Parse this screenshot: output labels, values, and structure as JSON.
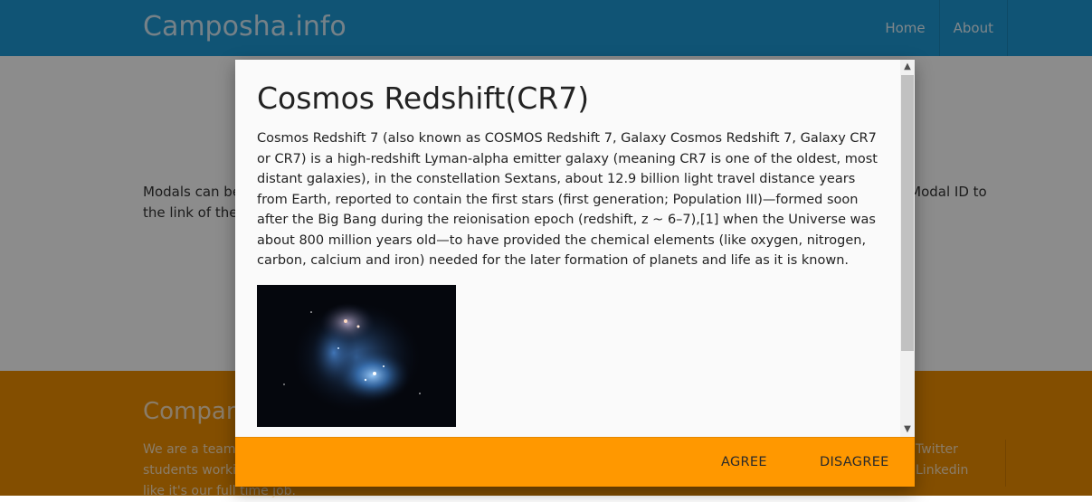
{
  "navbar": {
    "brand": "Camposha.info",
    "links": [
      "Home",
      "About"
    ]
  },
  "main": {
    "text": "Modals can be used for alerts, dialogs, preview lightboxes and more. For the modal to work you have to add the Modal ID to the link of the trigger."
  },
  "footer": {
    "title": "Company Bio",
    "text": "We are a team of college students working on this project like it's our full time job.",
    "links": [
      "Twitter",
      "Linkedin"
    ]
  },
  "modal": {
    "title": "Cosmos Redshift(CR7)",
    "body": "Cosmos Redshift 7 (also known as COSMOS Redshift 7, Galaxy Cosmos Redshift 7, Galaxy CR7 or CR7) is a high-redshift Lyman-alpha emitter galaxy (meaning CR7 is one of the oldest, most distant galaxies), in the constellation Sextans, about 12.9 billion light travel distance years from Earth, reported to contain the first stars (first generation; Population III)—formed soon after the Big Bang during the reionisation epoch (redshift, z ~ 6–7),[1] when the Universe was about 800 million years old—to have provided the chemical elements (like oxygen, nitrogen, carbon, calcium and iron) needed for the later formation of planets and life as it is known.",
    "agree_label": "AGREE",
    "disagree_label": "DISAGREE"
  },
  "icons": {
    "scroll_up": "chevron-up-icon",
    "scroll_down": "chevron-down-icon"
  },
  "colors": {
    "navbar": "#1e9ad6",
    "footer": "#ef8f00",
    "modal_footer": "#ff9800"
  }
}
